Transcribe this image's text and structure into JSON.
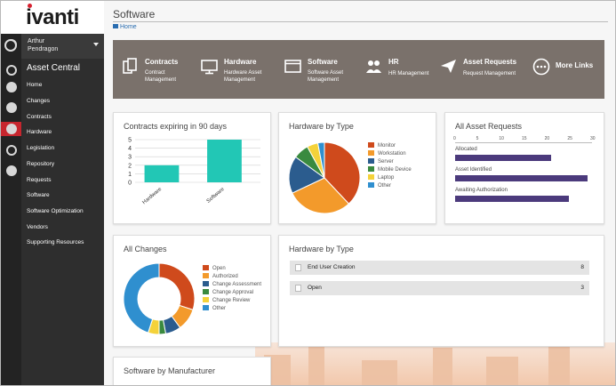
{
  "brand": {
    "logo_text": "ivanti"
  },
  "user": {
    "first_name": "Arthur",
    "last_name": "Pendragon"
  },
  "nav": {
    "section_title": "Asset Central",
    "items": [
      "Home",
      "Changes",
      "Contracts",
      "Hardware",
      "Legislation",
      "Repository",
      "Requests",
      "Software",
      "Software Optimization",
      "Vendors",
      "Supporting Resources"
    ]
  },
  "page": {
    "title": "Software",
    "breadcrumb": "Home"
  },
  "banner": {
    "tiles": [
      {
        "label": "Contracts",
        "sub1": "Contract",
        "sub2": "Management",
        "icon": "documents-icon"
      },
      {
        "label": "Hardware",
        "sub1": "Hardware Asset",
        "sub2": "Management",
        "icon": "monitor-icon"
      },
      {
        "label": "Software",
        "sub1": "Software Asset",
        "sub2": "Management",
        "icon": "window-icon"
      },
      {
        "label": "HR",
        "sub1": "HR Management",
        "sub2": "",
        "icon": "people-icon"
      },
      {
        "label": "Asset Requests",
        "sub1": "Request Management",
        "sub2": "",
        "icon": "paper-plane-icon"
      },
      {
        "label": "More Links",
        "sub1": "",
        "sub2": "",
        "icon": "more-icon"
      }
    ]
  },
  "cards": {
    "contracts": {
      "title": "Contracts expiring in 90 days"
    },
    "hardware_type": {
      "title": "Hardware by Type"
    },
    "asset_requests": {
      "title": "All Asset Requests"
    },
    "changes": {
      "title": "All Changes"
    },
    "hardware_type_list": {
      "title": "Hardware by Type",
      "rows": [
        {
          "label": "End User Creation",
          "value": "8"
        },
        {
          "label": "Open",
          "value": "3"
        }
      ]
    },
    "software_manufacturer": {
      "title": "Software by Manufacturer"
    }
  },
  "colors": {
    "accent_red": "#c6262e",
    "bar_teal": "#22c7b5",
    "bar_purple": "#4b3a7c"
  },
  "chart_data": [
    {
      "type": "bar",
      "title": "Contracts expiring in 90 days",
      "categories": [
        "Hardware",
        "Software"
      ],
      "values": [
        2,
        5
      ],
      "ylim": [
        0,
        5
      ],
      "yticks": [
        0,
        1,
        2,
        3,
        4,
        5
      ],
      "grid": true
    },
    {
      "type": "pie",
      "title": "Hardware by Type",
      "labels": [
        "Monitor",
        "Workstation",
        "Server",
        "Mobile Device",
        "Laptop",
        "Other"
      ],
      "values": [
        38,
        30,
        17,
        7,
        5,
        3
      ],
      "colors": [
        "#cf4a1c",
        "#f39a2b",
        "#2b5c8e",
        "#3a8a3f",
        "#f4d23a",
        "#2f8fcf"
      ],
      "legend": "right"
    },
    {
      "type": "bar",
      "orientation": "horizontal",
      "title": "All Asset Requests",
      "categories": [
        "Allocated",
        "Asset Identified",
        "Awaiting Authorization"
      ],
      "values": [
        21,
        29,
        25
      ],
      "xlim": [
        0,
        30
      ],
      "xticks": [
        0,
        5,
        10,
        15,
        20,
        25,
        30
      ]
    },
    {
      "type": "pie",
      "donut": true,
      "title": "All Changes",
      "labels": [
        "Open",
        "Authorized",
        "Change Assessment",
        "Change Approval",
        "Change Review",
        "Other"
      ],
      "values": [
        30,
        10,
        7,
        3,
        5,
        45
      ],
      "colors": [
        "#cf4a1c",
        "#f39a2b",
        "#2b5c8e",
        "#3a8a3f",
        "#f4d23a",
        "#2f8fcf"
      ],
      "legend": "right"
    }
  ]
}
